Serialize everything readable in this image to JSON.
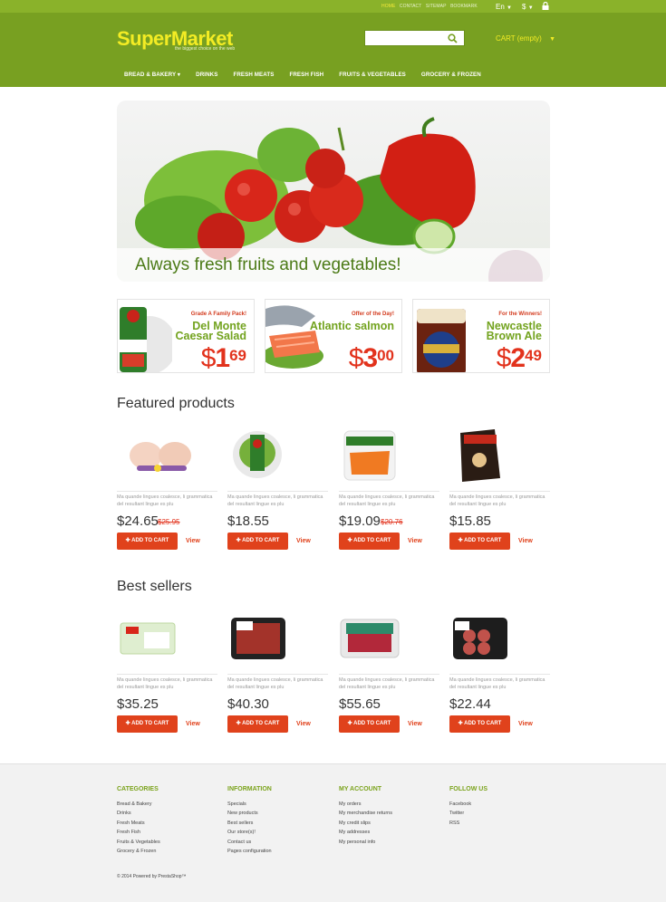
{
  "top": {
    "links": [
      "HOME",
      "CONTACT",
      "SITEMAP",
      "BOOKMARK"
    ],
    "language": "En",
    "currency": "$",
    "lock_icon": "lock-icon"
  },
  "header": {
    "logo": "SuperMarket",
    "tagline": "the biggest choice on the web",
    "search_placeholder": "",
    "cart": "CART (empty)"
  },
  "nav": [
    "BREAD & BAKERY",
    "DRINKS",
    "FRESH MEATS",
    "FRESH FISH",
    "FRUITS & VEGETABLES",
    "GROCERY & FROZEN"
  ],
  "hero": {
    "caption": "Always fresh fruits and vegetables!"
  },
  "promos": [
    {
      "tag": "Grade A Family Pack!",
      "name": "Del Monte Caesar Salad",
      "dollars": "1",
      "cents": "69"
    },
    {
      "tag": "Offer of the Day!",
      "name": "Atlantic salmon",
      "dollars": "3",
      "cents": "00"
    },
    {
      "tag": "For the Winners!",
      "name": "Newcastle Brown Ale",
      "dollars": "2",
      "cents": "49"
    }
  ],
  "featured": {
    "title": "Featured products",
    "items": [
      {
        "desc": "Ma quande lingues coalesce, li grammatica del resultant lingue es plu",
        "price": "$24.65",
        "old": "$25.95"
      },
      {
        "desc": "Ma quande lingues coalesce, li grammatica del resultant lingue es plu",
        "price": "$18.55",
        "old": ""
      },
      {
        "desc": "Ma quande lingues coalesce, li grammatica del resultant lingue es plu",
        "price": "$19.09",
        "old": "$20.76"
      },
      {
        "desc": "Ma quande lingues coalesce, li grammatica del resultant lingue es plu",
        "price": "$15.85",
        "old": ""
      }
    ]
  },
  "bestsellers": {
    "title": "Best sellers",
    "items": [
      {
        "desc": "Ma quande lingues coalesce, li grammatica del resultant lingue es plu",
        "price": "$35.25"
      },
      {
        "desc": "Ma quande lingues coalesce, li grammatica del resultant lingue es plu",
        "price": "$40.30"
      },
      {
        "desc": "Ma quande lingues coalesce, li grammatica del resultant lingue es plu",
        "price": "$55.65"
      },
      {
        "desc": "Ma quande lingues coalesce, li grammatica del resultant lingue es plu",
        "price": "$22.44"
      }
    ]
  },
  "buttons": {
    "add": "ADD TO CART",
    "view": "View"
  },
  "footer": {
    "categories": {
      "title": "CATEGORIES",
      "items": [
        "Bread & Bakery",
        "Drinks",
        "Fresh Meats",
        "Fresh Fish",
        "Fruits & Vegetables",
        "Grocery & Frozen"
      ]
    },
    "information": {
      "title": "INFORMATION",
      "items": [
        "Specials",
        "New products",
        "Best sellers",
        "Our store(s)!",
        "Contact us",
        "Pages configuration"
      ]
    },
    "account": {
      "title": "MY ACCOUNT",
      "items": [
        "My orders",
        "My merchandise returns",
        "My credit slips",
        "My addresses",
        "My personal info"
      ]
    },
    "follow": {
      "title": "FOLLOW US",
      "items": [
        "Facebook",
        "Twitter",
        "RSS"
      ]
    },
    "copyright": "© 2014 Powered by PrestaShop™"
  },
  "colors": {
    "green": "#78a021",
    "lightgreen": "#8ab22a",
    "accent": "#e0421c",
    "yellow": "#f3ec24"
  }
}
